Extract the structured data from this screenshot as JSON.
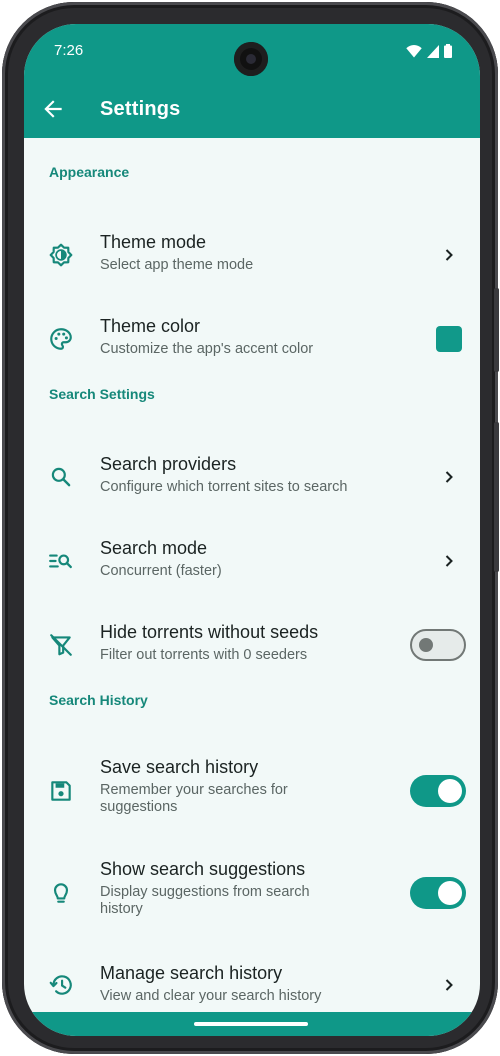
{
  "status": {
    "time": "7:26"
  },
  "appbar": {
    "title": "Settings"
  },
  "sections": {
    "appearance": {
      "header": "Appearance",
      "theme_mode": {
        "title": "Theme mode",
        "subtitle": "Select app theme mode"
      },
      "theme_color": {
        "title": "Theme color",
        "subtitle": "Customize the app's accent color",
        "color": "#11998a"
      }
    },
    "search_settings": {
      "header": "Search Settings",
      "providers": {
        "title": "Search providers",
        "subtitle": "Configure which torrent sites to search"
      },
      "mode": {
        "title": "Search mode",
        "subtitle": "Concurrent (faster)"
      },
      "hide_no_seeds": {
        "title": "Hide torrents without seeds",
        "subtitle": "Filter out torrents with 0 seeders",
        "enabled": false
      }
    },
    "search_history": {
      "header": "Search History",
      "save": {
        "title": "Save search history",
        "subtitle": "Remember your searches for suggestions",
        "enabled": true
      },
      "suggestions": {
        "title": "Show search suggestions",
        "subtitle": "Display suggestions from search history",
        "enabled": true
      },
      "manage": {
        "title": "Manage search history",
        "subtitle": "View and clear your search history"
      }
    }
  },
  "colors": {
    "accent": "#0f9888",
    "background": "#f2f9f8",
    "section_header": "#16887a"
  },
  "icons": [
    "arrow-back-icon",
    "brightness-icon",
    "palette-icon",
    "search-icon",
    "search-list-icon",
    "filter-off-icon",
    "save-icon",
    "lightbulb-icon",
    "history-icon",
    "chevron-right-icon"
  ]
}
